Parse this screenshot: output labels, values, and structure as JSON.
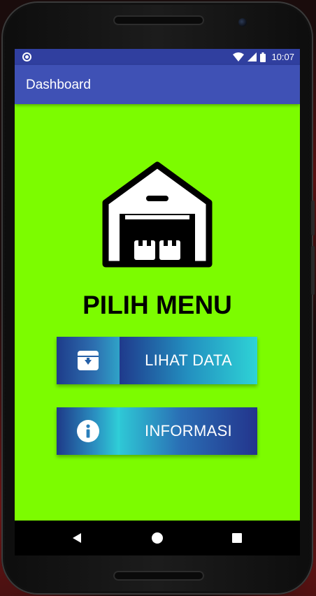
{
  "status_bar": {
    "time": "10:07",
    "icons": [
      "notification-dot-icon",
      "wifi-icon",
      "cellular-signal-icon",
      "battery-icon"
    ]
  },
  "app_bar": {
    "title": "Dashboard"
  },
  "main": {
    "hero_icon": "warehouse-icon",
    "heading": "PILIH MENU",
    "buttons": [
      {
        "label": "LIHAT DATA",
        "icon": "archive-download-icon"
      },
      {
        "label": "INFORMASI",
        "icon": "info-icon"
      }
    ]
  },
  "navigation_bar": {
    "icons": [
      "back-icon",
      "home-icon",
      "recents-icon"
    ]
  },
  "colors": {
    "screen_background": "#7cfc00",
    "status_bar": "#303f9f",
    "app_bar": "#3f51b5"
  }
}
